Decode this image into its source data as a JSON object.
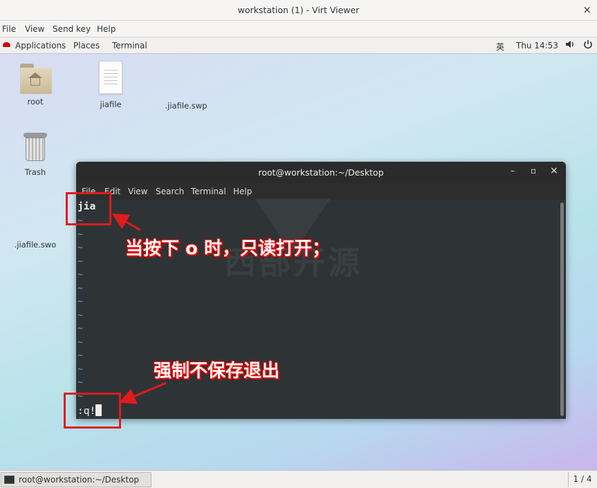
{
  "window": {
    "title": "workstation (1) - Virt Viewer",
    "close_glyph": "×"
  },
  "menubar": [
    "File",
    "View",
    "Send key",
    "Help"
  ],
  "gnome_panel": {
    "applications": "Applications",
    "places": "Places",
    "terminal": "Terminal",
    "input_method": "英",
    "clock": "Thu 14:53",
    "volume_icon": "volume-icon",
    "power_icon": "power-icon"
  },
  "desktop_icons": {
    "root": "root",
    "jiafile": "jiafile",
    "jiafile_swp": ".jiafile.swp",
    "trash": "Trash",
    "jiafile_swo": ".jiafile.swo"
  },
  "terminal": {
    "title": "root@workstation:~/Desktop",
    "minimize": "–",
    "maximize": "▫",
    "close": "×",
    "menu": [
      "File",
      "Edit",
      "View",
      "Search",
      "Terminal",
      "Help"
    ],
    "first_line": "jia",
    "tilde": "~",
    "command": ":q!"
  },
  "watermark": "西部开源",
  "annotations": {
    "top": "当按下 o 时，只读打开；",
    "bottom": "强制不保存退出"
  },
  "taskbar": {
    "item": "root@workstation:~/Desktop",
    "pager": "1 / 4"
  },
  "colors": {
    "annotation_red": "#e11b1b",
    "terminal_bg": "#2e3436",
    "tilde_blue": "#6a9fd8"
  }
}
